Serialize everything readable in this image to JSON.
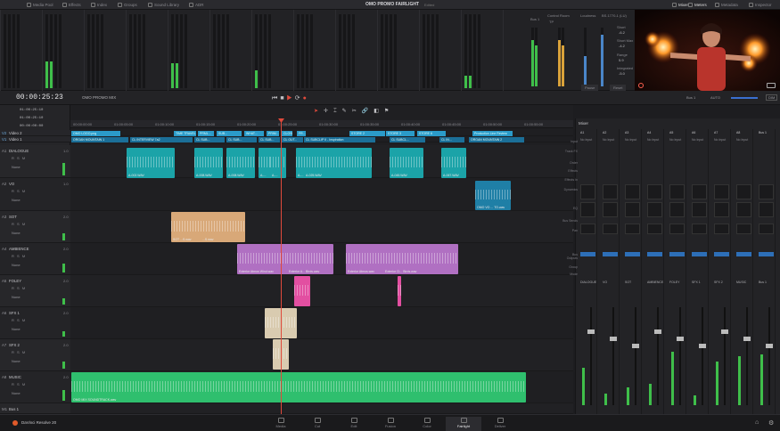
{
  "topbar": {
    "items": [
      "Media Pool",
      "Effects",
      "Index",
      "Groups",
      "Sound Library",
      "ADR"
    ],
    "title": "OMO PROMO FAIRLIGHT",
    "subtitle": "Edited",
    "right_items": [
      "Mixer",
      "Meters",
      "Metadata",
      "Inspector"
    ]
  },
  "meters_panel": {
    "bus_label": "Bus 1",
    "control_room_label": "Control Room",
    "control_room_sub": "TP",
    "loudness_label": "Loudness",
    "loudness_std": "BS.1770-1 (LU)",
    "loudness_stats": [
      {
        "label": "Short",
        "value": "-6.2"
      },
      {
        "label": "Short Max",
        "value": "-4.2"
      },
      {
        "label": "Range",
        "value": "5.9"
      },
      {
        "label": "Integrated",
        "value": "-5.0"
      }
    ],
    "pause_label": "Pause",
    "reset_label": "Reset"
  },
  "transport": {
    "timecode": "00:00:25:23",
    "timeline_name": "OMO PROMO MIX",
    "bus_label": "Bus 1",
    "auto_label": "AUTO",
    "dim_label": "DIM"
  },
  "timecodes": {
    "tc_top": [
      "01:00:25:10",
      "01:00:25:10",
      "00:00:00:00"
    ]
  },
  "ruler_ticks": [
    "00:00:00:00",
    "01:00:05:00",
    "01:00:10:00",
    "01:00:15:00",
    "01:00:20:00",
    "01:00:25:00",
    "01:00:30:00",
    "01:00:35:00",
    "01:00:40:00",
    "01:00:45:00",
    "01:00:50:00",
    "01:00:55:00"
  ],
  "video_tracks": [
    {
      "id": "V2",
      "name": "Video 2"
    },
    {
      "id": "V1",
      "name": "Video 1"
    }
  ],
  "video_clips_v2": [
    "OMO LOGO.png",
    "TIME TRAVEL",
    "PRML...",
    "SUB...",
    "WHAT...",
    "PRIM...",
    "CLOSE...",
    "FR...",
    "STORE 2",
    "STORE 3",
    "STORE 6",
    "Production Line Review"
  ],
  "video_clips_v1": [
    "ORGAN MOUNTAIN 1",
    "CL INTERVIEW 7a2",
    "CL SUB...",
    "CL SUB...",
    "CL SUB...",
    "CL OUT...",
    "CL SUBCLIP II - Inspiration",
    "CL SUBCL...",
    "CL IN...",
    "ORGAN MOUNTAIN 2"
  ],
  "audio_tracks": [
    {
      "id": "A1",
      "name": "DIALOGUE",
      "vol": "1.0",
      "route": "None"
    },
    {
      "id": "A2",
      "name": "VO",
      "vol": "1.0",
      "route": "None"
    },
    {
      "id": "A3",
      "name": "SOT",
      "vol": "2.0",
      "route": "None"
    },
    {
      "id": "A4",
      "name": "AMBIENCE",
      "vol": "2.0",
      "route": "None"
    },
    {
      "id": "A5",
      "name": "FOLEY",
      "vol": "2.0",
      "route": "None"
    },
    {
      "id": "A6",
      "name": "SFX 1",
      "vol": "2.0",
      "route": "None"
    },
    {
      "id": "A7",
      "name": "SFX 2",
      "vol": "2.0",
      "route": "None"
    },
    {
      "id": "A8",
      "name": "MUSIC",
      "vol": "2.0",
      "route": "None"
    },
    {
      "id": "M1",
      "name": "Bus 1",
      "vol": "",
      "route": ""
    }
  ],
  "audio_clips": {
    "dialogue": [
      "A-002.WAV",
      "A-008.WAV",
      "A-008.WAV",
      "A-...",
      "A-...",
      "A-...",
      "A-025.WAV",
      "A-045.WAV",
      "A-067.WAV"
    ],
    "vo": [
      "OMO VO ... TO.wav"
    ],
    "sot": [
      "SOT ...S.wav",
      "...S.wav"
    ],
    "ambience": [
      "Exterior Atmos Wind.wav",
      "Exterior A... Birds.wav",
      "Exterior Atmos.wav",
      "Exterior Ci... Birds.wav"
    ],
    "music": [
      "OMO MIX SOUNDTRACK.wav"
    ]
  },
  "mixer": {
    "title": "Mixer",
    "strips": [
      "A1",
      "A2",
      "A3",
      "A4",
      "A5",
      "A6",
      "A7",
      "A8",
      "Bus 1"
    ],
    "strip_names": [
      "DIALOGUE",
      "VO",
      "SOT",
      "AMBIENCE",
      "FOLEY",
      "SFX 1",
      "SFX 2",
      "MUSIC",
      "Bus 1"
    ],
    "row_labels": [
      "Input",
      "Track FX",
      "Order",
      "Effects",
      "Effects In",
      "Dynamics",
      "EQ",
      "Bus Sends",
      "Pan",
      "Bus Outputs",
      "Group",
      "Mode"
    ],
    "input_values": [
      "No Input",
      "No Input",
      "No Input",
      "No Input",
      "No Input",
      "No Input",
      "No Input",
      "No Input"
    ],
    "levels": [
      0.38,
      0.12,
      0.18,
      0.22,
      0.55,
      0.1,
      0.45,
      0.5,
      0.52
    ]
  },
  "bottom_pages": [
    "Media",
    "Cut",
    "Edit",
    "Fusion",
    "Color",
    "Fairlight",
    "Deliver"
  ],
  "active_page": "Fairlight",
  "app_name": "DaVinci Resolve 20",
  "colors": {
    "dialogue": "#1ba3a8",
    "vo": "#1f7fa6",
    "sot": "#d8a878",
    "ambience": "#b070c2",
    "foley": "#e24fa1",
    "sfx": "#d9cbb0",
    "music": "#2fbf6e",
    "video": "#2b9bc9",
    "playhead": "#e04a3c"
  }
}
